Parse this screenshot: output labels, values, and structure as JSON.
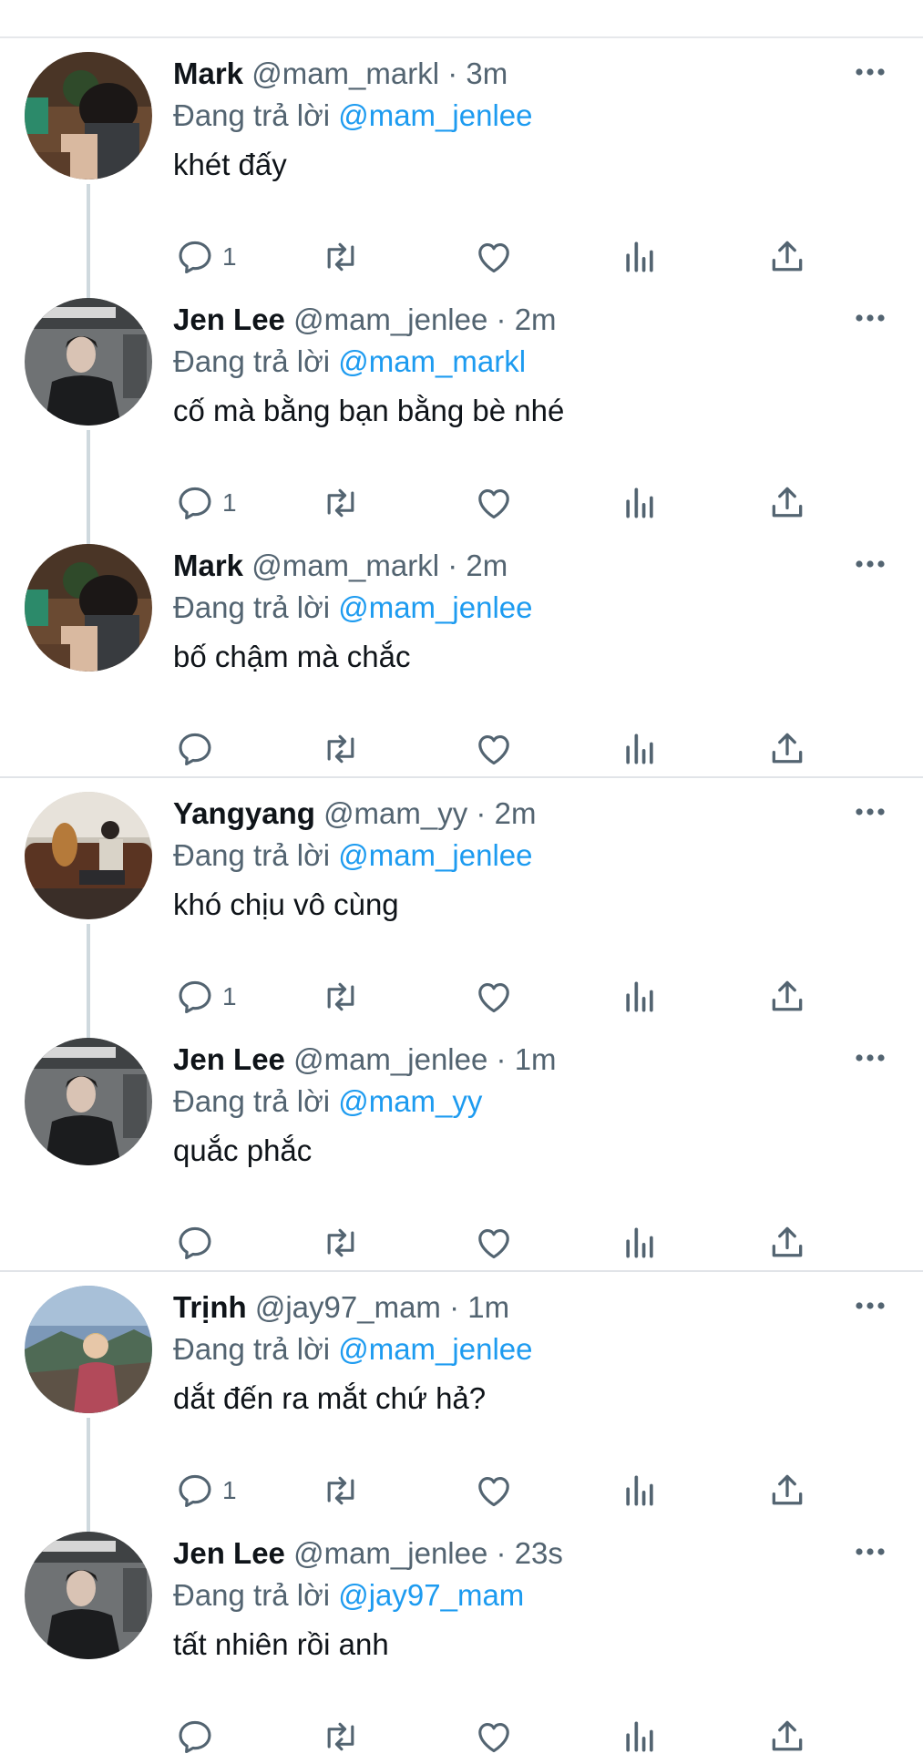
{
  "reply_prefix": "Đang trả lời",
  "colors": {
    "mention": "#1d9bf0",
    "secondary": "#536471",
    "text": "#0f1419"
  },
  "tweets": [
    {
      "name": "Mark",
      "handle": "@mam_markl",
      "dot": "·",
      "time": "3m",
      "reply_to": "@mam_jenlee",
      "text": "khét đấy",
      "reply_count": "1",
      "avatar": "mark-avatar"
    },
    {
      "name": "Jen Lee",
      "handle": "@mam_jenlee",
      "dot": "·",
      "time": "2m",
      "reply_to": "@mam_markl",
      "text": "cố mà bằng bạn bằng bè nhé",
      "reply_count": "1",
      "avatar": "jenlee-avatar"
    },
    {
      "name": "Mark",
      "handle": "@mam_markl",
      "dot": "·",
      "time": "2m",
      "reply_to": "@mam_jenlee",
      "text": "bố chậm mà chắc",
      "reply_count": "",
      "avatar": "mark-avatar"
    },
    {
      "name": "Yangyang",
      "handle": "@mam_yy",
      "dot": "·",
      "time": "2m",
      "reply_to": "@mam_jenlee",
      "text": "khó chịu vô cùng",
      "reply_count": "1",
      "avatar": "yangyang-avatar"
    },
    {
      "name": "Jen Lee",
      "handle": "@mam_jenlee",
      "dot": "·",
      "time": "1m",
      "reply_to": "@mam_yy",
      "text": "quắc phắc",
      "reply_count": "",
      "avatar": "jenlee-avatar"
    },
    {
      "name": "Trịnh",
      "handle": "@jay97_mam",
      "dot": "·",
      "time": "1m",
      "reply_to": "@mam_jenlee",
      "text": "dắt đến ra mắt chứ hả?",
      "reply_count": "1",
      "avatar": "trinh-avatar"
    },
    {
      "name": "Jen Lee",
      "handle": "@mam_jenlee",
      "dot": "·",
      "time": "23s",
      "reply_to": "@jay97_mam",
      "text": "tất nhiên rồi anh",
      "reply_count": "",
      "avatar": "jenlee-avatar"
    }
  ]
}
